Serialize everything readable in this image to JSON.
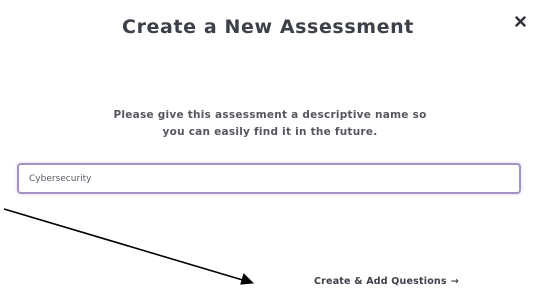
{
  "modal": {
    "title": "Create a New Assessment",
    "close_icon": "close-icon",
    "description_line1": "Please give this assessment a descriptive name so",
    "description_line2": "you can easily find it in the future.",
    "name_input": {
      "value": "Cybersecurity"
    },
    "create_button": {
      "label": "Create & Add Questions",
      "icon": "arrow-right-icon",
      "icon_glyph": "→"
    }
  },
  "annotation": {
    "icon": "pointer-arrow"
  },
  "colors": {
    "title": "#3d4049",
    "input_border": "#a392c4",
    "text": "#55575e"
  }
}
